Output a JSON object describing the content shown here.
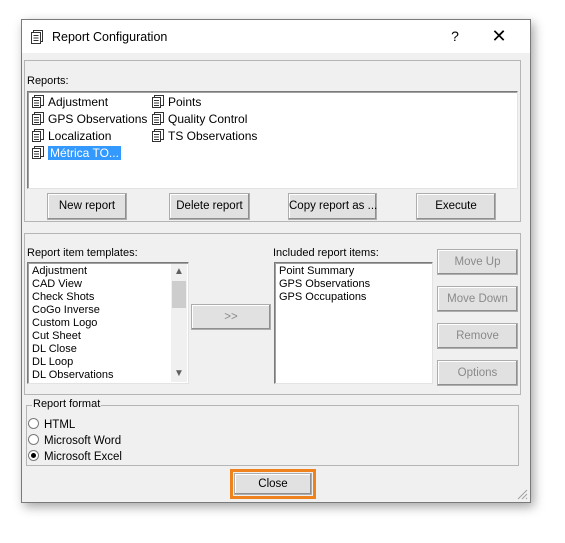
{
  "window": {
    "title": "Report Configuration",
    "help_label": "?",
    "close_glyph": "✕"
  },
  "reports": {
    "label": "Reports:",
    "items": [
      {
        "label": "Adjustment",
        "icon": "report-icon"
      },
      {
        "label": "GPS Observations",
        "icon": "report-icon"
      },
      {
        "label": "Localization",
        "icon": "report-icon"
      },
      {
        "label": "Métrica TO...",
        "icon": "report-icon",
        "selected": true
      },
      {
        "label": "Points",
        "icon": "report-icon"
      },
      {
        "label": "Quality Control",
        "icon": "report-icon"
      },
      {
        "label": "TS Observations",
        "icon": "report-icon"
      }
    ],
    "buttons": {
      "new": "New report",
      "delete": "Delete report",
      "copy": "Copy report as ...",
      "execute": "Execute"
    }
  },
  "templates": {
    "label": "Report item templates:",
    "items": [
      "Adjustment",
      "CAD View",
      "Check Shots",
      "CoGo Inverse",
      "Custom Logo",
      "Cut Sheet",
      "DL Close",
      "DL Loop",
      "DL Observations"
    ],
    "add_label": ">>"
  },
  "included": {
    "label": "Included report items:",
    "items": [
      "Point Summary",
      "GPS Observations",
      "GPS Occupations"
    ]
  },
  "side_buttons": {
    "move_up": "Move Up",
    "move_down": "Move Down",
    "remove": "Remove",
    "options": "Options"
  },
  "format": {
    "label": "Report format",
    "options": [
      {
        "label": "HTML",
        "checked": false
      },
      {
        "label": "Microsoft Word",
        "checked": false
      },
      {
        "label": "Microsoft Excel",
        "checked": true
      }
    ]
  },
  "footer": {
    "close_label": "Close",
    "highlight_color": "#f0821e"
  },
  "colors": {
    "selection": "#3399ff",
    "dialog_bg": "#f0f0f0"
  }
}
